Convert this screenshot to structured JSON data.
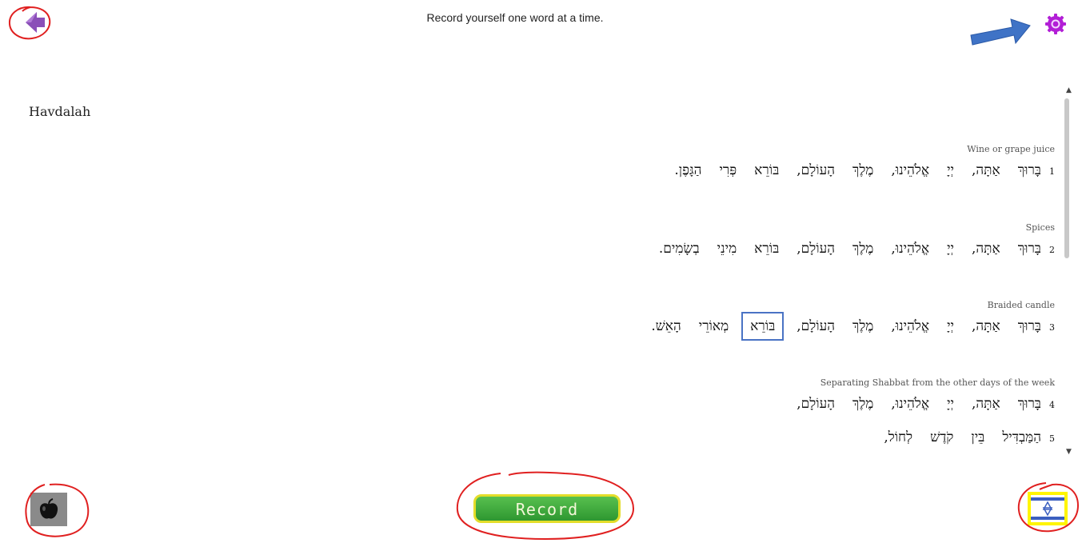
{
  "header": {
    "instruction": "Record yourself one word at a time."
  },
  "document": {
    "title": "Havdalah",
    "blessings": [
      {
        "caption": "Wine or grape juice",
        "lines": [
          {
            "number": "1",
            "words": [
              "בָּרוּךְ",
              "אַתָּה,",
              "יְיָ",
              "אֱלֹהֵינוּ,",
              "מֶלֶךְ",
              "הָעוֹלָם,",
              "בּוֹרֵא",
              "פְּרִי",
              "הַגָּפֶן."
            ]
          }
        ]
      },
      {
        "caption": "Spices",
        "lines": [
          {
            "number": "2",
            "words": [
              "בָּרוּךְ",
              "אַתָּה,",
              "יְיָ",
              "אֱלֹהֵינוּ,",
              "מֶלֶךְ",
              "הָעוֹלָם,",
              "בּוֹרֵא",
              "מִינֵי",
              "בְשָׂמִים."
            ]
          }
        ]
      },
      {
        "caption": "Braided candle",
        "lines": [
          {
            "number": "3",
            "words": [
              "בָּרוּךְ",
              "אַתָּה,",
              "יְיָ",
              "אֱלֹהֵינוּ,",
              "מֶלֶךְ",
              "הָעוֹלָם,",
              "בּוֹרֵא",
              "מְאוֹרֵי",
              "הָאֵשׁ."
            ],
            "active_word": 6
          }
        ]
      },
      {
        "caption": "Separating Shabbat from the other days of the week",
        "lines": [
          {
            "number": "4",
            "words": [
              "בָּרוּךְ",
              "אַתָּה,",
              "יְיָ",
              "אֱלֹהֵינוּ,",
              "מֶלֶךְ",
              "הָעוֹלָם,"
            ]
          },
          {
            "number": "5",
            "words": [
              "הַמַּבְדִּיל",
              "בֵּין",
              "קֹדֶשׁ",
              "לְחוֹל,"
            ]
          }
        ]
      }
    ]
  },
  "footer": {
    "record_label": "Record"
  },
  "icons": {
    "back": "back-arrow-icon",
    "settings": "gear-icon",
    "apple": "apple-icon",
    "flag": "israel-flag-icon"
  },
  "colors": {
    "back_arrow": "#8a4fb8",
    "settings_gear": "#b21fd6",
    "record_green": "#3fae3c",
    "record_border": "#e3dd2a",
    "annotation_red": "#e02020",
    "annotation_blue": "#3f73c6",
    "active_word_outline": "#4a73c4"
  }
}
